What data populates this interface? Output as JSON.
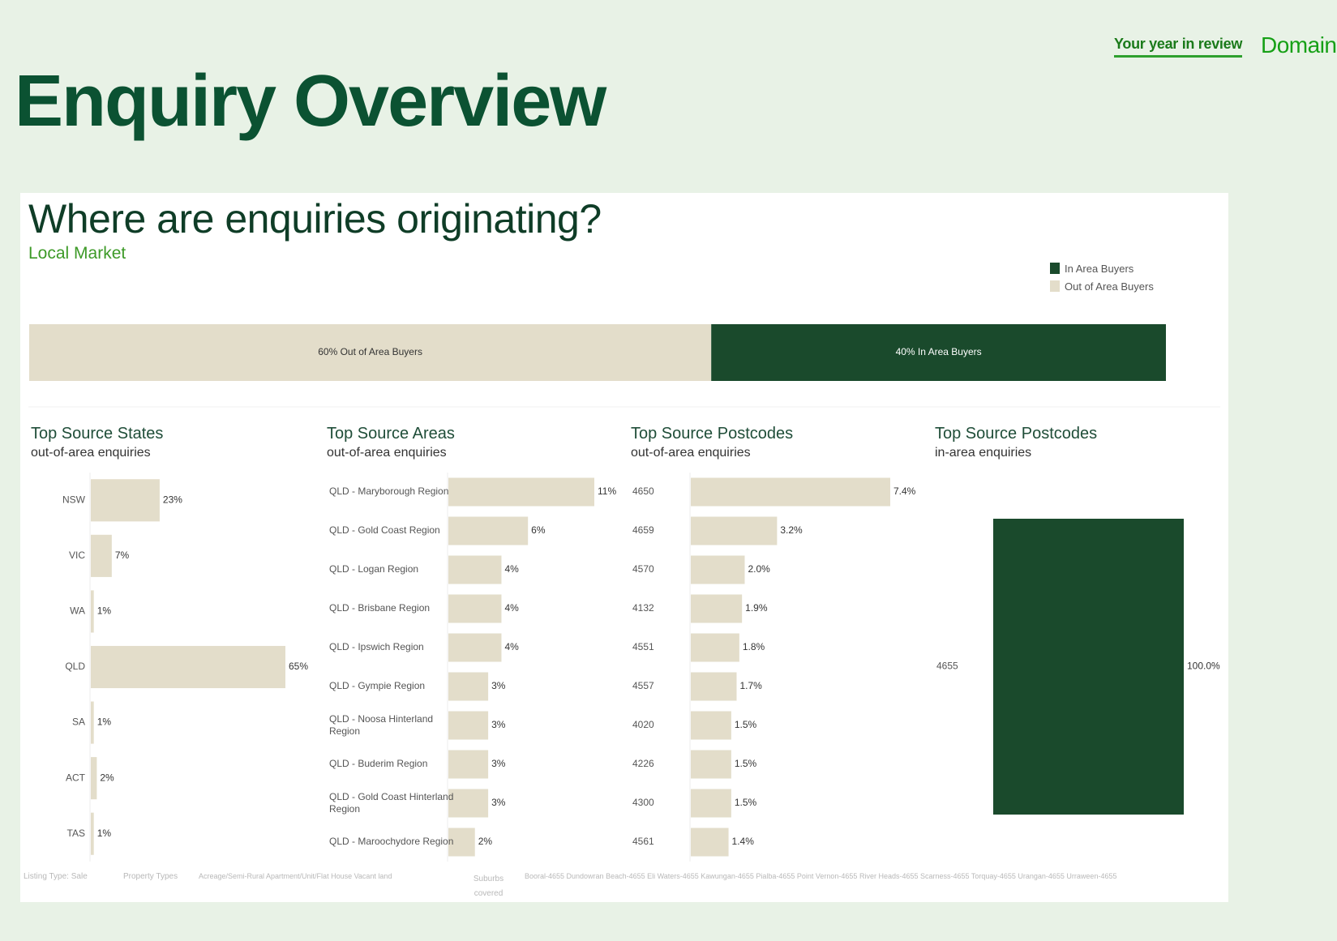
{
  "header": {
    "nav_link": "Your year in review",
    "brand": "Domain",
    "page_title": "Enquiry Overview"
  },
  "panel": {
    "title": "Where are enquiries originating?",
    "subtitle": "Local Market"
  },
  "colors": {
    "in_area": "#1a4a2c",
    "out_area": "#e3ddca",
    "accent_green": "#3d9a28",
    "title_green": "#0b5232"
  },
  "chart_data": [
    {
      "type": "bar",
      "orientation": "horizontal-stacked",
      "legend": [
        "In Area Buyers",
        "Out of Area Buyers"
      ],
      "legend_position": "top-right",
      "segments": [
        {
          "name": "Out of Area Buyers",
          "value": 60,
          "label": "60% Out of Area Buyers"
        },
        {
          "name": "In Area Buyers",
          "value": 40,
          "label": "40% In Area Buyers"
        }
      ]
    },
    {
      "type": "bar",
      "orientation": "horizontal",
      "title": "Top Source States",
      "subtitle": "out-of-area enquiries",
      "categories": [
        "NSW",
        "VIC",
        "WA",
        "QLD",
        "SA",
        "ACT",
        "TAS"
      ],
      "values": [
        23,
        7,
        1,
        65,
        1,
        2,
        1
      ],
      "labels": [
        "23%",
        "7%",
        "1%",
        "65%",
        "1%",
        "2%",
        "1%"
      ]
    },
    {
      "type": "bar",
      "orientation": "horizontal",
      "title": "Top Source Areas",
      "subtitle": "out-of-area enquiries",
      "categories": [
        "QLD - Maryborough Region",
        "QLD - Gold Coast Region",
        "QLD - Logan Region",
        "QLD - Brisbane Region",
        "QLD - Ipswich Region",
        "QLD - Gympie Region",
        "QLD - Noosa Hinterland Region",
        "QLD - Buderim Region",
        "QLD - Gold Coast Hinterland Region",
        "QLD - Maroochydore Region"
      ],
      "values": [
        11,
        6,
        4,
        4,
        4,
        3,
        3,
        3,
        3,
        2
      ],
      "labels": [
        "11%",
        "6%",
        "4%",
        "4%",
        "4%",
        "3%",
        "3%",
        "3%",
        "3%",
        "2%"
      ]
    },
    {
      "type": "bar",
      "orientation": "horizontal",
      "title": "Top Source Postcodes",
      "subtitle": "out-of-area enquiries",
      "categories": [
        "4650",
        "4659",
        "4570",
        "4132",
        "4551",
        "4557",
        "4020",
        "4226",
        "4300",
        "4561"
      ],
      "values": [
        7.4,
        3.2,
        2.0,
        1.9,
        1.8,
        1.7,
        1.5,
        1.5,
        1.5,
        1.4
      ],
      "labels": [
        "7.4%",
        "3.2%",
        "2.0%",
        "1.9%",
        "1.8%",
        "1.7%",
        "1.5%",
        "1.5%",
        "1.5%",
        "1.4%"
      ]
    },
    {
      "type": "bar",
      "orientation": "horizontal",
      "title": "Top Source Postcodes",
      "subtitle": "in-area enquiries",
      "categories": [
        "4655"
      ],
      "values": [
        100.0
      ],
      "labels": [
        "100.0%"
      ]
    }
  ],
  "footer": {
    "listing_type": "Listing Type: Sale",
    "property_types_label": "Property Types",
    "property_types": "Acreage/Semi-Rural   Apartment/Unit/Flat   House   Vacant land",
    "suburbs_label": "Suburbs covered",
    "suburbs": "Booral-4655   Dundowran Beach-4655   Eli Waters-4655   Kawungan-4655   Pialba-4655   Point Vernon-4655   River Heads-4655   Scarness-4655   Torquay-4655   Urangan-4655   Urraween-4655"
  }
}
